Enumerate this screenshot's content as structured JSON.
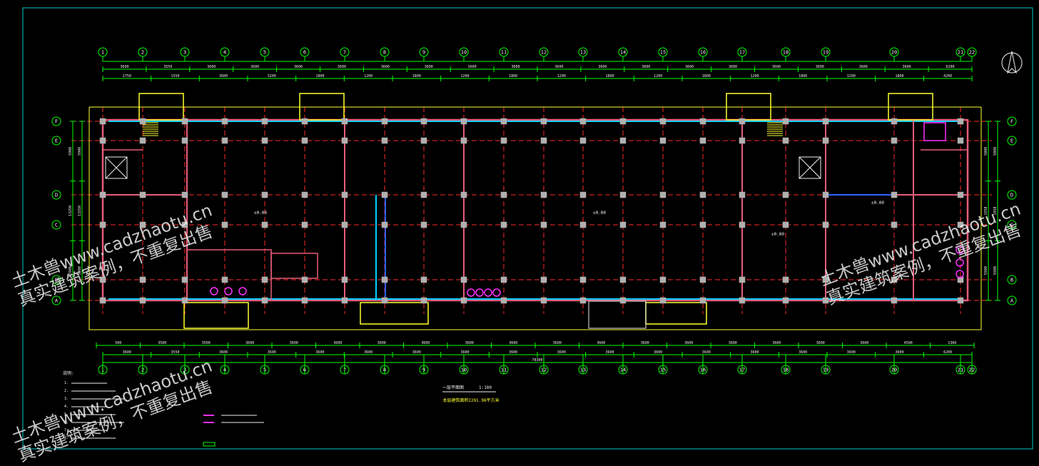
{
  "grid": {
    "columns": [
      "1",
      "2",
      "3",
      "4",
      "5",
      "6",
      "7",
      "8",
      "9",
      "10",
      "11",
      "12",
      "13",
      "14",
      "15",
      "16",
      "17",
      "18",
      "19",
      "20",
      "21",
      "22"
    ],
    "rows": [
      "A",
      "B",
      "C",
      "D",
      "E",
      "F"
    ]
  },
  "dimensions": {
    "top_row1": [
      "3600",
      "3550",
      "3600",
      "3600",
      "3600",
      "3600",
      "3600",
      "3600",
      "3600",
      "3600",
      "3600",
      "3600",
      "3600",
      "3600",
      "3600",
      "3600",
      "3600",
      "3600",
      "3600",
      "6200"
    ],
    "top_row2": [
      "1750",
      "1550",
      "3600",
      "3200",
      "1800",
      "1200",
      "1800",
      "1200",
      "1800",
      "1200",
      "1800",
      "1200",
      "1800",
      "1200",
      "1800",
      "1200",
      "1800",
      "4200"
    ],
    "bottom_row1": [
      "500",
      "3500",
      "3500",
      "3600",
      "3600",
      "3600",
      "3600",
      "3600",
      "3600",
      "3600",
      "3600",
      "3600",
      "3600",
      "3600",
      "3600",
      "3600",
      "3600",
      "3600",
      "4500",
      "1360"
    ],
    "bottom_row2": [
      "3600",
      "3550",
      "3600",
      "3600",
      "3600",
      "3600",
      "3600",
      "3600",
      "3600",
      "3600",
      "3600",
      "3600",
      "3600",
      "3600",
      "3600",
      "3600",
      "3600",
      "6200"
    ],
    "total": "78300",
    "side_left": [
      "5900",
      "13250",
      "5900"
    ],
    "side_right": [
      "5000",
      "1950",
      "5900"
    ]
  },
  "title": {
    "name": "一层平面图",
    "scale": "1:100",
    "area": "本层建筑面积2291.96平方米"
  },
  "room_labels": [
    "±0.00",
    "±0.00",
    "±0.00",
    "±0.00"
  ],
  "notes": {
    "heading": "说明:",
    "items": [
      "1.",
      "2.",
      "3.",
      "4.",
      "5.",
      "6.",
      "7.",
      "8."
    ]
  },
  "watermarks": [
    {
      "line1": "土木兽www.cadzhaotu.cn",
      "line2": "真实建筑案例，不重复出售"
    },
    {
      "line1": "土木兽www.cadzhaotu.cn",
      "line2": "真实建筑案例，不重复出售"
    },
    {
      "line1": "土木兽www.cadzhaotu.cn",
      "line2": "真实建筑案例，不重复出售"
    }
  ],
  "colors": {
    "frame": "#00c8c8",
    "grid_axis": "#ff2828",
    "dimension": "#00ff00",
    "wall": "#e85c7a",
    "window": "#00d0ff",
    "column": "#b0b0b0",
    "outline": "#ffff30",
    "accent": "#ff30ff",
    "text": "#f0f0f0"
  },
  "icons": {
    "north_arrow": "north-arrow-icon"
  }
}
